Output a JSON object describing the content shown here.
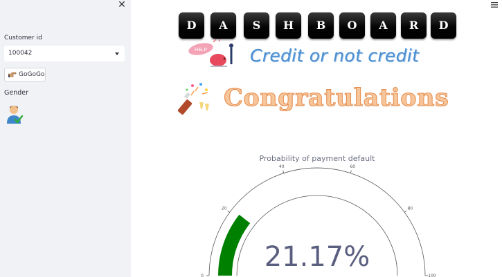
{
  "sidebar": {
    "close_icon": "close-icon",
    "customer_label": "Customer id",
    "customer_value": "100042",
    "button_label": "GoGoGo",
    "gender_label": "Gender"
  },
  "header": {
    "letters": [
      "D",
      "A",
      "S",
      "H",
      "B",
      "O",
      "A",
      "R",
      "D"
    ],
    "help_label": "HELP",
    "subtitle": "Credit or not credit",
    "congrats": "Congratulations"
  },
  "chart_data": {
    "type": "gauge",
    "title": "Probability of payment default",
    "value": 21.17,
    "value_label": "21.17%",
    "range": [
      0,
      100
    ],
    "ticks": [
      0,
      20,
      40,
      60,
      80,
      100
    ],
    "bar_color": "#008000"
  }
}
